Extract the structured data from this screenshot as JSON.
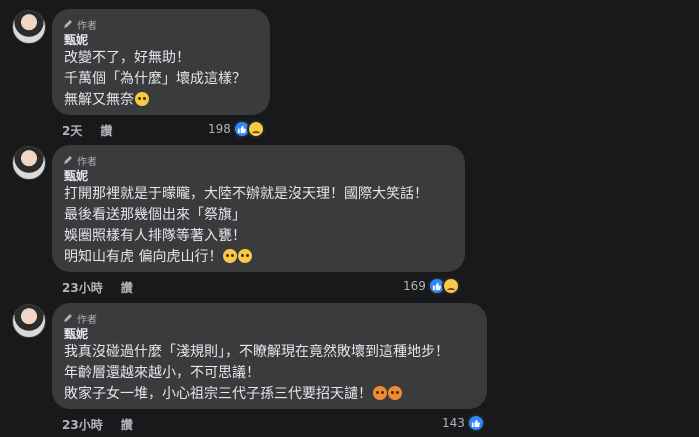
{
  "comments": [
    {
      "author_tag": "作者",
      "name": "甄妮",
      "lines": [
        "改變不了，好無助！",
        "千萬個「為什麼」壞成這樣？",
        "無解又無奈"
      ],
      "time": "2天",
      "reply": "讚",
      "reaction_count": "198",
      "reactions": [
        "like",
        "sad"
      ]
    },
    {
      "author_tag": "作者",
      "name": "甄妮",
      "lines": [
        "打開那裡就是于曚矓，大陸不辦就是沒天理！國際大笑話！",
        "最後看送那幾個出來「祭旗」",
        "娛圈照樣有人排隊等著入甕！",
        "明知山有虎 偏向虎山行！"
      ],
      "time": "23小時",
      "reply": "讚",
      "reaction_count": "169",
      "reactions": [
        "like",
        "sad"
      ]
    },
    {
      "author_tag": "作者",
      "name": "甄妮",
      "lines": [
        "我真沒碰過什麼「淺規則」，不瞭解現在竟然敗壞到這種地步！",
        "年齡層還越來越小，不可思議！",
        "敗家子女一堆，小心祖宗三代子孫三代要招天譴！"
      ],
      "time": "23小時",
      "reply": "讚",
      "reaction_count": "143",
      "reactions": [
        "like"
      ]
    }
  ]
}
